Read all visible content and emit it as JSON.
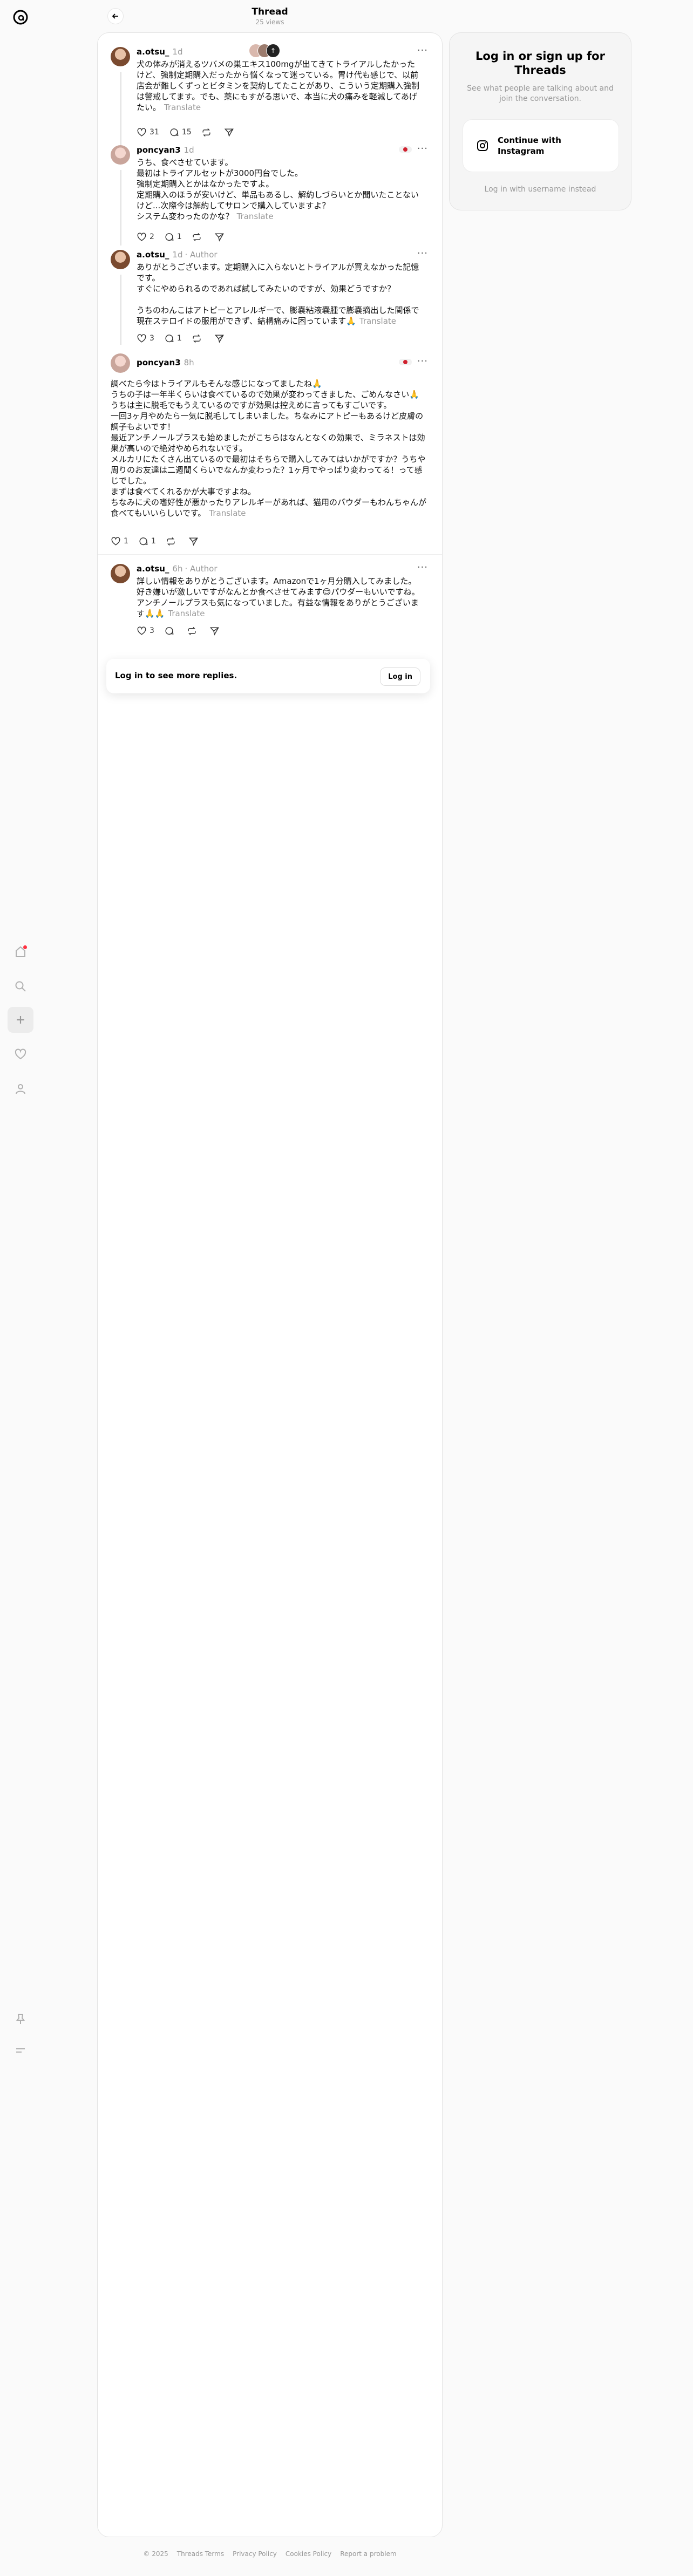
{
  "header": {
    "title": "Thread",
    "views": "25 views"
  },
  "posts": [
    {
      "name": "a.otsu_",
      "time": "1d",
      "author": "",
      "text": "犬の体みが消えるツバメの巣エキス100mgが出てきてトライアルしたかったけど、強制定期購入だったから悩くなって迷っている。胃け代も感じで、以前店会が難しくずっとビタミンを契約してたことがあり、こういう定期購入強制は警戒してます。でも、薬にもすがる思いで、本当に犬の痛みを軽減してあげたい。",
      "translate": "Translate",
      "likes": "31",
      "replies": "15",
      "reposts": "",
      "shares": ""
    },
    {
      "name": "poncyan3",
      "time": "1d",
      "author": "",
      "text": "うち、食べさせています。\n最初はトライアルセットが3000円台でした。\n強制定期購入とかはなかったですよ。\n定期購入のほうが安いけど、単品もあるし、解約しづらいとか聞いたことないけど...次際今は解約してサロンで購入していますよ？\nシステム変わったのかな？",
      "translate": "Translate",
      "likes": "2",
      "replies": "1",
      "reposts": "",
      "shares": ""
    },
    {
      "name": "a.otsu_",
      "time": "1d",
      "author": "Author",
      "text": "ありがとうございます。定期購入に入らないとトライアルが買えなかった記憶です。\nすぐにやめられるのであれば試してみたいのですが、効果どうですか？\n\nうちのわんこはアトピーとアレルギーで、膨嚢粘液嚢腫で膨嚢摘出した関係で現在ステロイドの服用ができず、結構痛みに困っています🙏",
      "translate": "Translate",
      "likes": "3",
      "replies": "1",
      "reposts": "",
      "shares": ""
    },
    {
      "name": "poncyan3",
      "time": "8h",
      "author": "",
      "text": "調べたら今はトライアルもそんな感じになってましたね🙏\nうちの子は一年半くらいは食べているので効果が変わってきました、ごめんなさい🙏\nうちは主に脱毛でもうえているのですが効果は控えめに言ってもすごいです。\n一回3ヶ月やめたら一気に脱毛してしまいました。ちなみにアトピーもあるけど皮膚の調子もよいです！\n最近アンチノールプラスも始めましたがこちらはなんとなくの効果で、ミラネストは効果が高いので絶対やめられないです。\nメルカリにたくさん出ているので最初はそちらで購入してみてはいかがですか？うちや周りのお友達は二週間くらいでなんか変わった？1ヶ月でやっぱり変わってる！って感じでした。\nまずは食べてくれるかが大事ですよね。\nちなみに犬の嗜好性が悪かったりアレルギーがあれば、猫用のパウダーもわんちゃんが食べてもいいらしいです。",
      "translate": "Translate",
      "likes": "1",
      "replies": "1",
      "reposts": "",
      "shares": ""
    },
    {
      "name": "a.otsu_",
      "time": "6h",
      "author": "Author",
      "text": "詳しい情報をありがとうございます。Amazonで1ヶ月分購入してみました。好き嫌いが激しいですがなんとか食べさせてみます😊パウダーもいいですね。アンチノールプラスも気になっていました。有益な情報をありがとうございます🙏🙏",
      "translate": "Translate",
      "likes": "3",
      "replies": "",
      "reposts": "",
      "shares": ""
    }
  ],
  "login_prompt": {
    "text": "Log in to see more replies.",
    "button": "Log in"
  },
  "panel": {
    "title": "Log in or sign up for Threads",
    "subtitle": "See what people are talking about and join the conversation.",
    "instagram_button": "Continue with Instagram",
    "username_link": "Log in with username instead"
  },
  "footer": [
    "© 2025",
    "Threads Terms",
    "Privacy Policy",
    "Cookies Policy",
    "Report a problem"
  ],
  "colors": {
    "accent": "#ff3040",
    "muted": "#999999",
    "card_border": "#e3e3e3"
  }
}
